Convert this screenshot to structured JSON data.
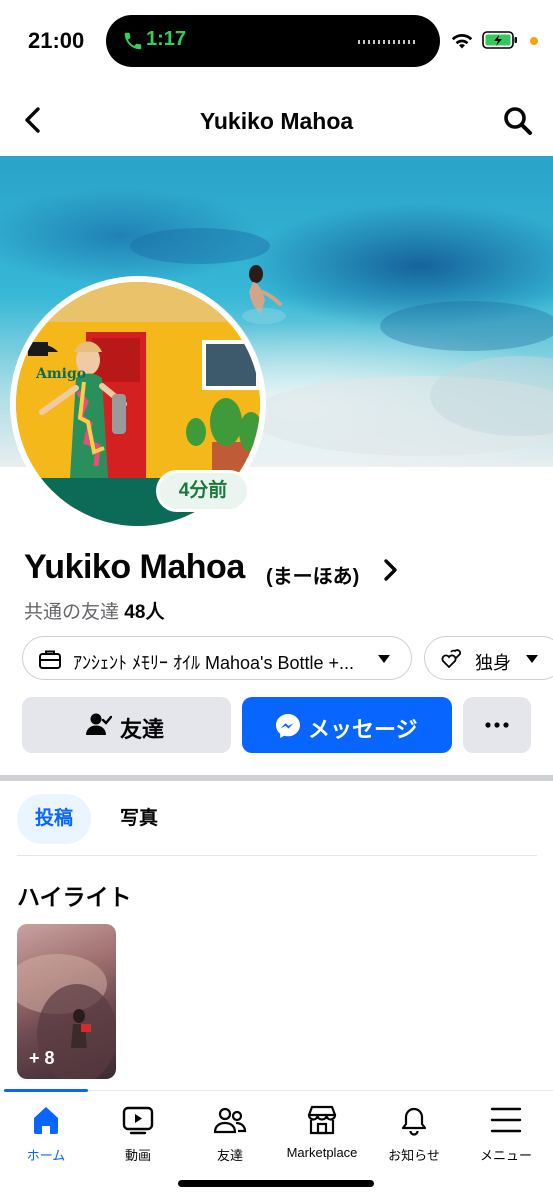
{
  "status_bar": {
    "time": "21:00",
    "call_timer": "1:17",
    "call_icon": "phone-icon",
    "call_color": "#2fd158"
  },
  "header": {
    "title": "Yukiko Mahoa",
    "back_icon": "chevron-left-icon",
    "search_icon": "search-icon"
  },
  "profile": {
    "name": "Yukiko Mahoa",
    "alternate_name": "(まーほあ)",
    "mutual_label": "共通の友達",
    "mutual_count": "48",
    "mutual_unit": "人",
    "avatar_badge": "4分前",
    "avatar_sign_text": "Amigo"
  },
  "chips": {
    "work": "ｱﾝｼｪﾝﾄ ﾒﾓﾘｰ ｵｲﾙ Mahoa's Bottle +...",
    "relationship": "独身"
  },
  "actions": {
    "friends": "友達",
    "message": "メッセージ",
    "more": "more-horizontal-icon"
  },
  "tabs": [
    {
      "label": "投稿",
      "active": true
    },
    {
      "label": "写真",
      "active": false
    }
  ],
  "highlights": {
    "title": "ハイライト",
    "card_count": "+ 8"
  },
  "bottom_nav": [
    {
      "label": "ホーム",
      "icon": "home-icon",
      "active": true
    },
    {
      "label": "動画",
      "icon": "video-icon",
      "active": false
    },
    {
      "label": "友達",
      "icon": "friends-icon",
      "active": false
    },
    {
      "label": "Marketplace",
      "icon": "marketplace-icon",
      "active": false
    },
    {
      "label": "お知らせ",
      "icon": "bell-icon",
      "active": false
    },
    {
      "label": "メニュー",
      "icon": "menu-icon",
      "active": false
    }
  ],
  "colors": {
    "accent": "#0866ff",
    "button_gray": "#e4e6eb",
    "badge_green": "#1a7a3a"
  }
}
